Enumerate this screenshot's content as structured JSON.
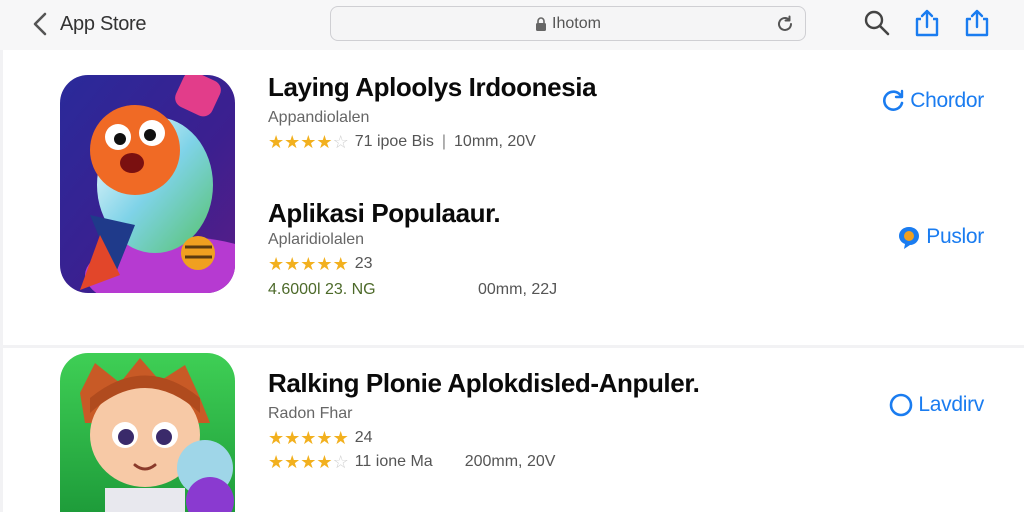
{
  "nav": {
    "back_label": "App Store",
    "url_text": "Ihotom"
  },
  "apps": [
    {
      "title": "Laying Aploolys Irdoonesia",
      "subtitle": "Appandiolalen",
      "rating": 4,
      "rating_text": "71 ipoe Bis",
      "size_text": "10mm, 20V",
      "button_label": "Chordor"
    },
    {
      "title": "Aplikasi Populaaur.",
      "subtitle": "Aplaridiolalen",
      "rating": 4.5,
      "rating_text": "23",
      "meta_left": "4.6000l 23. NG",
      "meta_right": "00mm, 22J",
      "button_label": "Puslor"
    },
    {
      "title": "Ralking Plonie Aplokdisled-Anpuler.",
      "subtitle": "Radon Fhar",
      "rating": 4.5,
      "rating_text": "24",
      "rating2": 4,
      "meta_left": "11 ione Ma",
      "meta_right": "200mm, 20V",
      "button_label": "Lavdirv"
    }
  ],
  "colors": {
    "accent": "#1a7cf0",
    "star": "#f2b01e"
  }
}
